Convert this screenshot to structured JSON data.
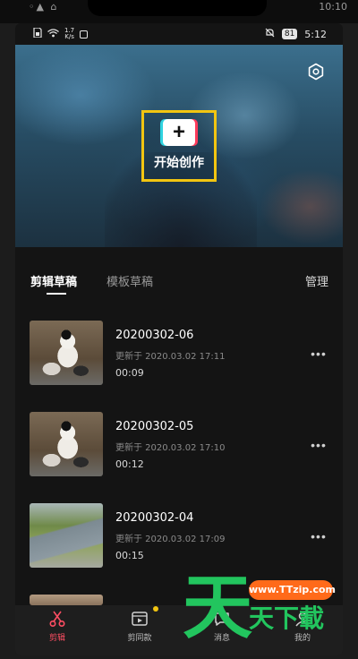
{
  "device": {
    "top_signal": "◦▲ ⌂",
    "top_clock": "10:10"
  },
  "status_bar": {
    "speed_value": "1.7",
    "speed_unit": "K/s",
    "battery": "81",
    "time": "5:12"
  },
  "hero": {
    "create_label": "开始创作",
    "create_icon": "plus-icon",
    "settings_icon": "settings-icon"
  },
  "tabs": {
    "items": [
      {
        "label": "剪辑草稿",
        "active": true
      },
      {
        "label": "模板草稿",
        "active": false
      }
    ],
    "manage_label": "管理"
  },
  "drafts": [
    {
      "title": "20200302-06",
      "updated": "更新于 2020.03.02 17:11",
      "duration": "00:09",
      "thumb": "panda"
    },
    {
      "title": "20200302-05",
      "updated": "更新于 2020.03.02 17:10",
      "duration": "00:12",
      "thumb": "panda"
    },
    {
      "title": "20200302-04",
      "updated": "更新于 2020.03.02 17:09",
      "duration": "00:15",
      "thumb": "road"
    }
  ],
  "more_glyph": "•••",
  "bottom_nav": [
    {
      "label": "剪辑",
      "icon": "scissors-icon",
      "active": true
    },
    {
      "label": "剪同款",
      "icon": "template-icon",
      "active": false,
      "badge": true
    },
    {
      "label": "消息",
      "icon": "message-icon",
      "active": false
    },
    {
      "label": "我的",
      "icon": "profile-icon",
      "active": false
    }
  ],
  "watermark": {
    "big_char": "天",
    "url": "www.TTzip.com",
    "chars": "天下載"
  },
  "colors": {
    "accent_yellow": "#f2c511",
    "active_nav": "#ff4e63",
    "watermark_green": "#22c55e",
    "watermark_orange": "#ff6a1a"
  }
}
